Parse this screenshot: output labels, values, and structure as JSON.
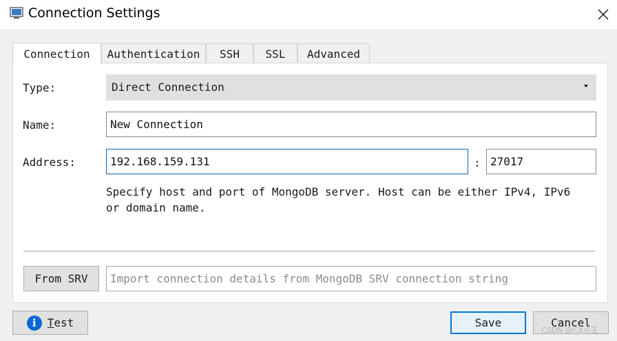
{
  "window": {
    "title": "Connection Settings"
  },
  "tabs": [
    {
      "label": "Connection",
      "active": true
    },
    {
      "label": "Authentication",
      "active": false
    },
    {
      "label": "SSH",
      "active": false
    },
    {
      "label": "SSL",
      "active": false
    },
    {
      "label": "Advanced",
      "active": false
    }
  ],
  "connection": {
    "type_label": "Type:",
    "type_value": "Direct Connection",
    "name_label": "Name:",
    "name_value": "New Connection",
    "address_label": "Address:",
    "host_value": "192.168.159.131",
    "port_separator": ":",
    "port_value": "27017",
    "help_text": "Specify host and port of MongoDB server. Host can be either IPv4, IPv6 or domain name."
  },
  "srv": {
    "button_label": "From SRV",
    "placeholder": "Import connection details from MongoDB SRV connection string"
  },
  "footer": {
    "test_label": "Test",
    "save_label": "Save",
    "cancel_label": "Cancel"
  },
  "watermark": "CSDN @CX小王",
  "colors": {
    "accent": "#0078d4",
    "info_icon": "#0a6ad1"
  },
  "icons": {
    "app": "monitor-icon",
    "close": "close-icon",
    "info": "info-icon",
    "dropdown": "caret-down-icon"
  }
}
